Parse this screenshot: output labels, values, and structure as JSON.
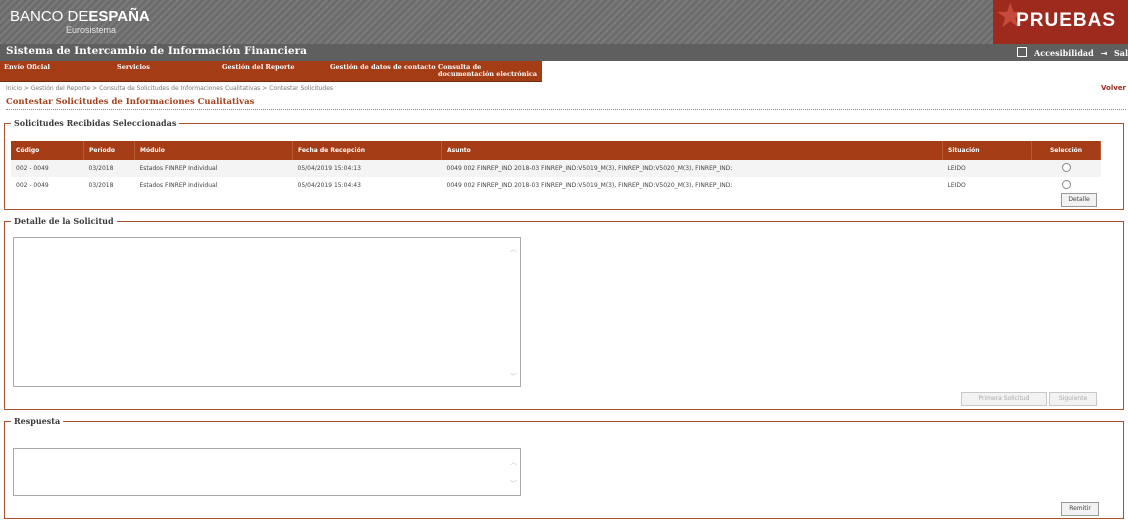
{
  "header": {
    "logo_banco": "BANCO DE",
    "logo_espana": "ESPAÑA",
    "logo_sub": "Eurosistema",
    "env_badge": "PRUEBAS",
    "system_title": "Sistema de Intercambio de Información Financiera",
    "accessibility": "Accesibilidad",
    "exit": "Sal"
  },
  "menu": [
    "Envío Oficial",
    "Servicios",
    "Gestión del Reporte",
    "Gestión de datos de contacto",
    "Consulta de documentación electrónica"
  ],
  "breadcrumb": "Inicio > Gestión del Reporte > Consulta de Solicitudes de Informaciones Cualitativas > Contestar Solicitudes",
  "volver": "Volver",
  "page_title": "Contestar Solicitudes de Informaciones Cualitativas",
  "solicitudes": {
    "legend": "Solicitudes Recibidas Seleccionadas",
    "columns": [
      "Código",
      "Periodo",
      "Módulo",
      "Fecha de Recepción",
      "Asunto",
      "Situación",
      "Selección"
    ],
    "rows": [
      [
        "002 - 0049",
        "03/2018",
        "Estados FINREP Individual",
        "05/04/2019 15:04:13",
        "0049 002 FINREP_IND 2018-03 FINREP_IND:V5019_M(3), FINREP_IND:V5020_M(3), FINREP_IND:",
        "LEIDO"
      ],
      [
        "002 - 0049",
        "03/2018",
        "Estados FINREP Individual",
        "05/04/2019 15:04:43",
        "0049 002 FINREP_IND 2018-03 FINREP_IND:V5019_M(3), FINREP_IND:V5020_M(3), FINREP_IND:",
        "LEIDO"
      ]
    ],
    "detalle_button": "Detalle"
  },
  "detalle": {
    "legend": "Detalle de la Solicitud",
    "text": "",
    "primera_button": "Primera Solicitud",
    "siguiente_button": "Siguiente"
  },
  "respuesta": {
    "legend": "Respuesta",
    "text": "",
    "remitir_button": "Remitir"
  }
}
